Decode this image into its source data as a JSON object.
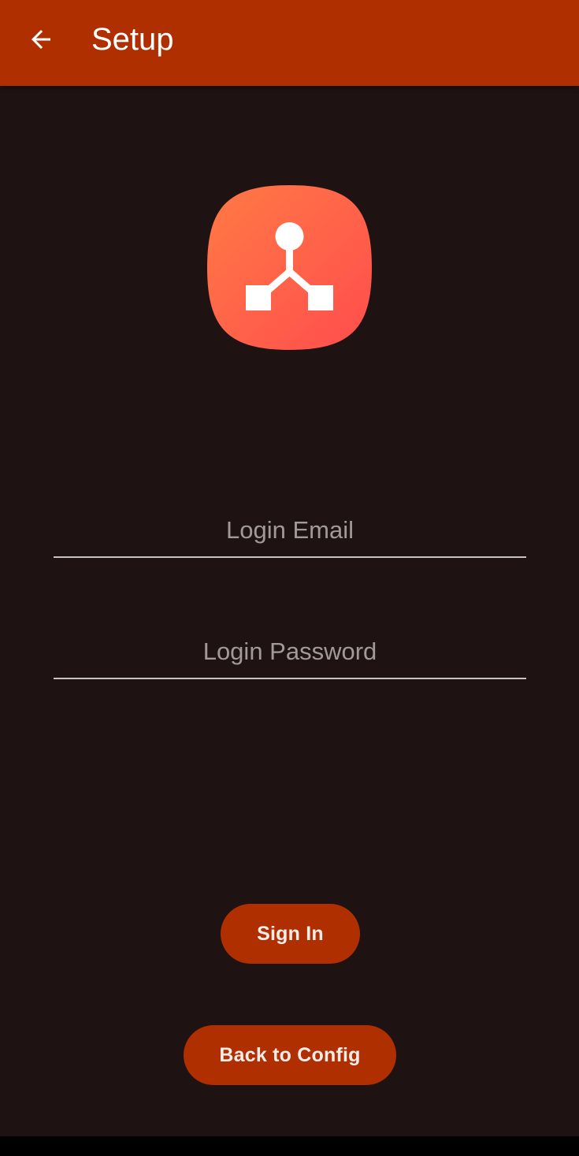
{
  "appbar": {
    "title": "Setup",
    "background_color": "#b02f00",
    "back_icon": "arrow-left-icon"
  },
  "logo": {
    "icon": "network-hierarchy-icon",
    "gradient": [
      "#ff7a45",
      "#ff4d4d"
    ]
  },
  "form": {
    "email": {
      "placeholder": "Login Email",
      "value": ""
    },
    "password": {
      "placeholder": "Login Password",
      "value": ""
    }
  },
  "buttons": {
    "sign_in": "Sign In",
    "back_to_config": "Back to Config"
  },
  "theme": {
    "background": "#1e1312",
    "accent": "#b02f00"
  }
}
